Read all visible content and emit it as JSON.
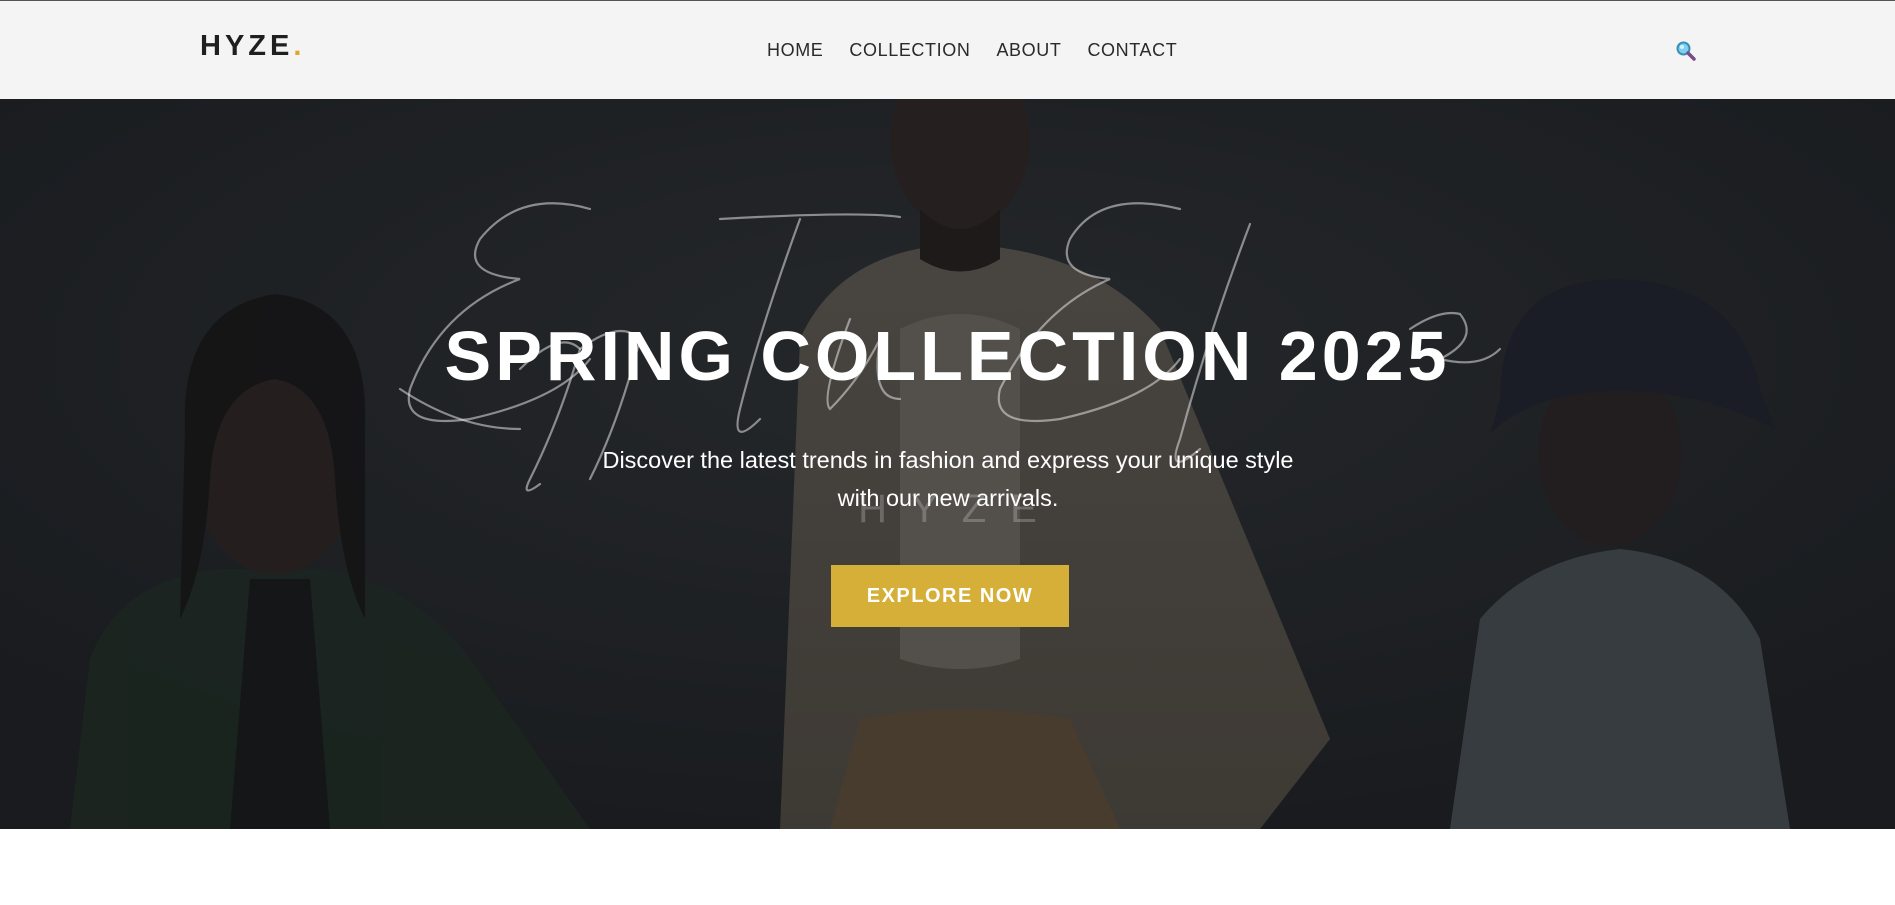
{
  "header": {
    "logo_text": "HYZE",
    "logo_dot": ".",
    "nav": [
      {
        "label": "HOME"
      },
      {
        "label": "COLLECTION"
      },
      {
        "label": "ABOUT"
      },
      {
        "label": "CONTACT"
      }
    ],
    "search_icon": "search-icon"
  },
  "hero": {
    "script_text": "Effortless Elegance",
    "watermark": "HYZE",
    "title": "SPRING COLLECTION 2025",
    "subtitle_line1": "Discover the latest trends in fashion and express your unique style",
    "subtitle_line2": "with our new arrivals.",
    "cta_label": "EXPLORE NOW"
  },
  "colors": {
    "header_bg": "#f4f4f4",
    "logo_accent": "#e0a52a",
    "hero_overlay": "#1e2124",
    "cta_bg": "#d5af37",
    "text_light": "#ffffff"
  }
}
